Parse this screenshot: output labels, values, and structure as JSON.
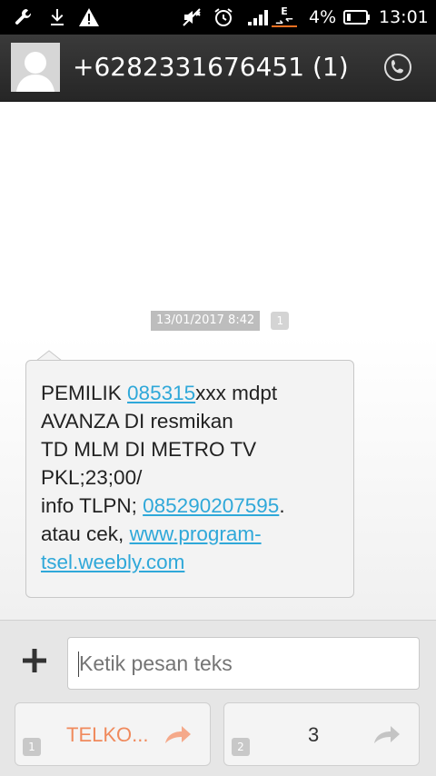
{
  "status_bar": {
    "battery_percent": "4%",
    "time": "13:01",
    "network_type": "E",
    "icons": [
      "wrench-icon",
      "download-icon",
      "warning-icon",
      "mute-icon",
      "alarm-icon",
      "signal-icon",
      "data-arrows-icon",
      "battery-icon"
    ]
  },
  "header": {
    "contact_title": "+6282331676451 (1)",
    "icons": [
      "avatar",
      "phone-call-icon"
    ]
  },
  "conversation": {
    "timestamp": "13/01/2017 8:42",
    "sim_badge": "1",
    "message": {
      "lines": [
        [
          {
            "t": "PEMILIK ",
            "link": false
          },
          {
            "t": "085315",
            "link": true
          },
          {
            "t": "xxx mdpt",
            "link": false
          }
        ],
        [
          {
            "t": "AVANZA DI resmikan",
            "link": false
          }
        ],
        [
          {
            "t": "TD MLM DI METRO TV",
            "link": false
          }
        ],
        [
          {
            "t": "PKL;23;00/",
            "link": false
          }
        ],
        [
          {
            "t": "info TLPN; ",
            "link": false
          },
          {
            "t": "085290207595",
            "link": true
          },
          {
            "t": ".",
            "link": false
          }
        ],
        [
          {
            "t": "atau cek, ",
            "link": false
          },
          {
            "t": "www.program-",
            "link": true
          }
        ],
        [
          {
            "t": "tsel.weebly.com",
            "link": true
          }
        ]
      ]
    }
  },
  "compose": {
    "placeholder": "Ketik pesan teks",
    "send_sim1_label": "TELKO...",
    "send_sim1_num": "1",
    "send_sim2_label": "3",
    "send_sim2_num": "2"
  },
  "colors": {
    "link": "#2fa8d9",
    "telkomsel_orange": "#f08a5d",
    "header_bg": "#2e2e2e",
    "timestamp_bg": "#bdbdbd"
  }
}
